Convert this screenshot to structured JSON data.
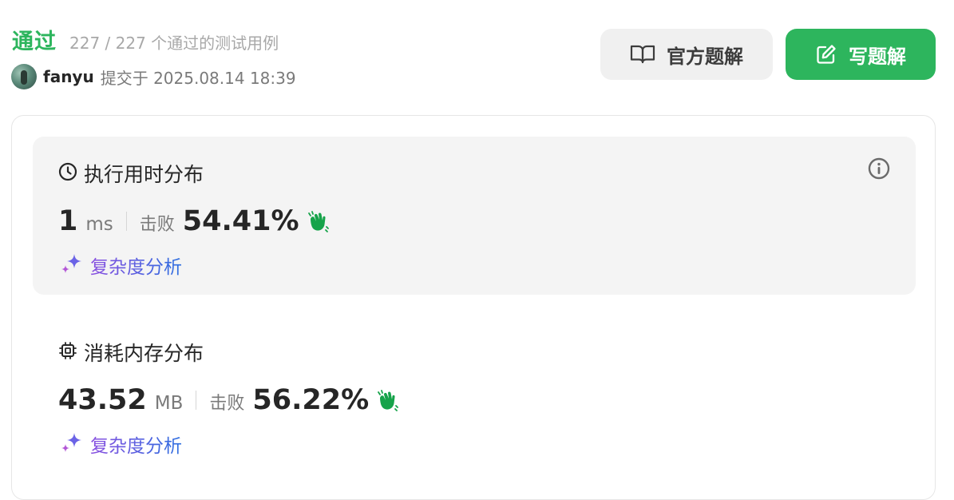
{
  "status": {
    "title": "通过",
    "count_text": "227 / 227 个通过的测试用例"
  },
  "submission": {
    "username": "fanyu",
    "submitted_text": "提交于 2025.08.14 18:39"
  },
  "buttons": {
    "official_solution": "官方题解",
    "write_solution": "写题解"
  },
  "runtime": {
    "title": "执行用时分布",
    "value": "1",
    "unit": "ms",
    "beat_label": "击败",
    "beat_percent": "54.41%",
    "complexity_link": "复杂度分析"
  },
  "memory": {
    "title": "消耗内存分布",
    "value": "43.52",
    "unit": "MB",
    "beat_label": "击败",
    "beat_percent": "56.22%",
    "complexity_link": "复杂度分析"
  },
  "colors": {
    "accent_green": "#2db55d",
    "clap_green": "#16a34a",
    "sparkle_purple": "#8a4fe0"
  },
  "icons": {
    "official_solution": "book-icon",
    "write_solution": "edit-icon",
    "runtime": "clock-icon",
    "memory": "chip-icon",
    "info": "info-icon",
    "beat": "clapping-hands-icon",
    "complexity": "sparkles-icon"
  }
}
